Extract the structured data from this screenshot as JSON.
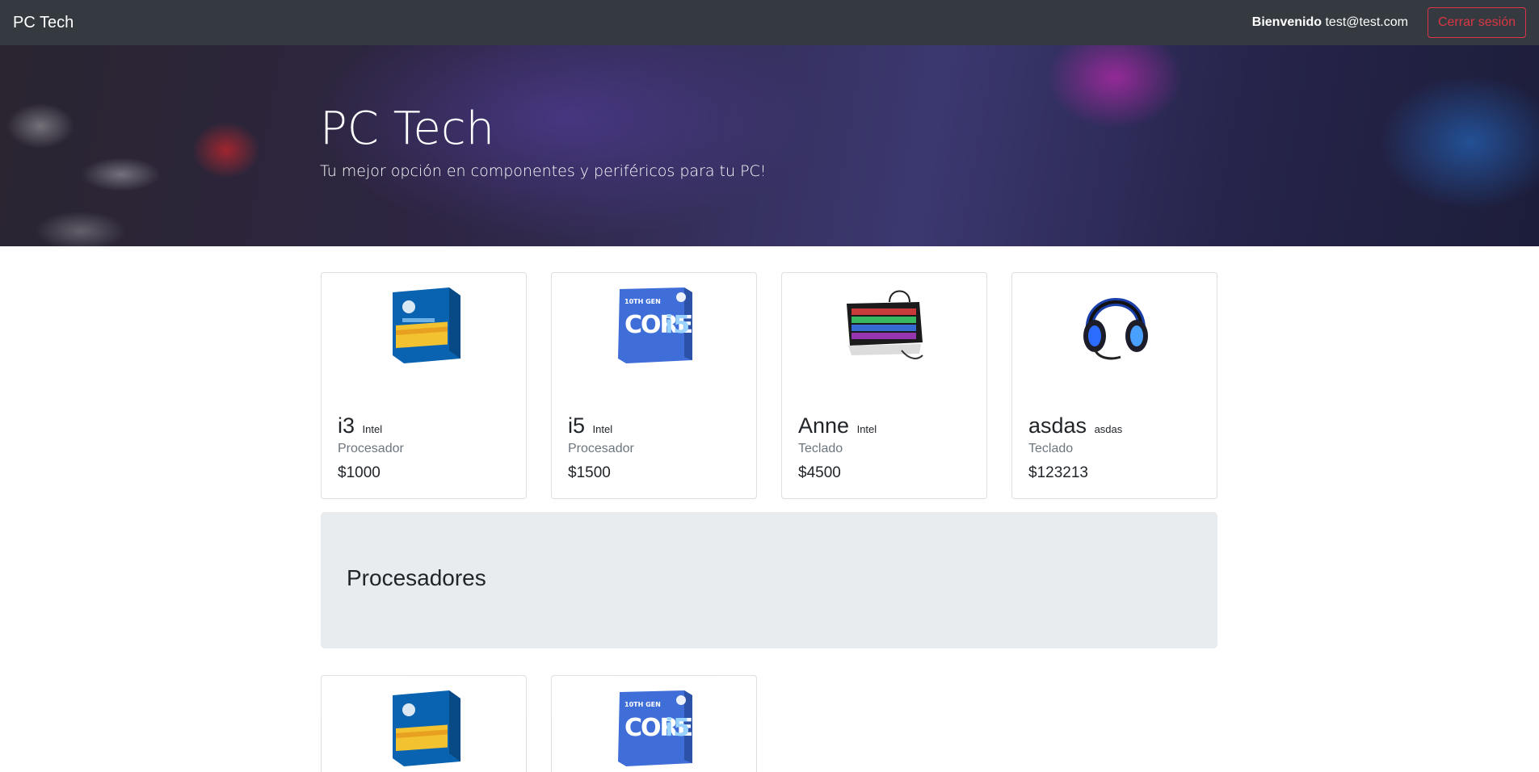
{
  "navbar": {
    "brand": "PC Tech",
    "welcome_label": "Bienvenido",
    "user_email": "test@test.com",
    "logout_label": "Cerrar sesión"
  },
  "hero": {
    "title": "PC Tech",
    "subtitle": "Tu mejor opción en componentes y periféricos para tu PC!"
  },
  "featured_products": [
    {
      "name": "i3",
      "brand": "Intel",
      "category": "Procesador",
      "price": "$1000",
      "image": "intel-core-i3-box-image"
    },
    {
      "name": "i5",
      "brand": "Intel",
      "category": "Procesador",
      "price": "$1500",
      "image": "intel-core-i5-box-image"
    },
    {
      "name": "Anne",
      "brand": "Intel",
      "category": "Teclado",
      "price": "$4500",
      "image": "rgb-keyboard-image"
    },
    {
      "name": "asdas",
      "brand": "asdas",
      "category": "Teclado",
      "price": "$123213",
      "image": "gaming-headset-image"
    }
  ],
  "section": {
    "title": "Procesadores"
  },
  "section_products": [
    {
      "image": "intel-core-i3-box-image"
    },
    {
      "image": "intel-core-i5-box-image"
    }
  ],
  "colors": {
    "navbar": "#343a40",
    "danger": "#dc3545",
    "jumbotron": "#e9ecef",
    "muted": "#6c757d"
  }
}
